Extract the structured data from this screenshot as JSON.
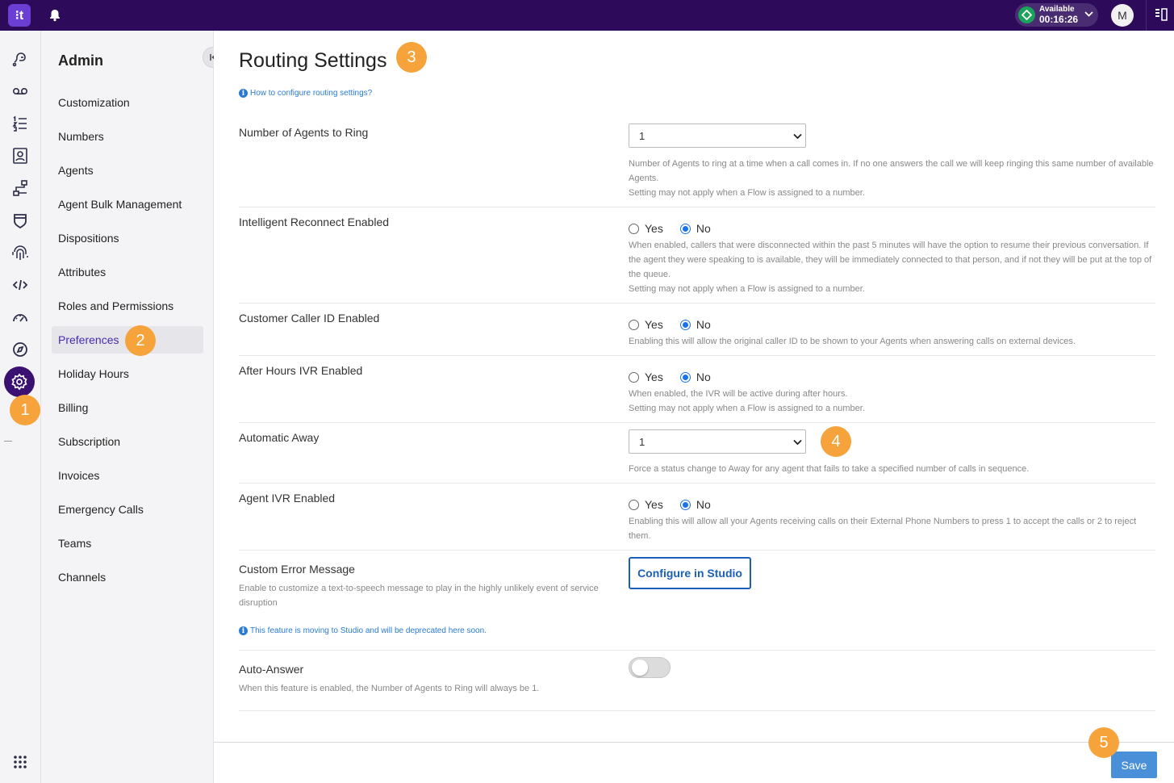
{
  "topbar": {
    "logo_text": "⁝t",
    "status_label": "Available",
    "status_timer": "00:16:26",
    "avatar_initial": "M",
    "bg_color": "#2d0b5a",
    "status_color": "#1aa35b"
  },
  "rail": {
    "icons": [
      "conversations-icon",
      "voicemail-icon",
      "list-icon",
      "contacts-icon",
      "flows-icon",
      "shield-icon",
      "fingerprint-icon",
      "code-icon",
      "dashboard-icon",
      "compass-icon",
      "settings-icon",
      "apps-grid-icon"
    ],
    "active": "settings-icon"
  },
  "sidebar": {
    "title": "Admin",
    "items": [
      {
        "label": "Customization"
      },
      {
        "label": "Numbers"
      },
      {
        "label": "Agents"
      },
      {
        "label": "Agent Bulk Management"
      },
      {
        "label": "Dispositions"
      },
      {
        "label": "Attributes"
      },
      {
        "label": "Roles and Permissions"
      },
      {
        "label": "Preferences"
      },
      {
        "label": "Holiday Hours"
      },
      {
        "label": "Billing"
      },
      {
        "label": "Subscription"
      },
      {
        "label": "Invoices"
      },
      {
        "label": "Emergency Calls"
      },
      {
        "label": "Teams"
      },
      {
        "label": "Channels"
      }
    ],
    "active": "Preferences"
  },
  "badges": [
    "1",
    "2",
    "3",
    "4",
    "5"
  ],
  "main": {
    "title": "Routing Settings",
    "help_link": "How to configure routing settings?",
    "agents_to_ring": {
      "label": "Number of Agents to Ring",
      "value": "1",
      "desc1": "Number of Agents to ring at a time when a call comes in. If no one answers the call we will keep ringing this same number of available Agents.",
      "desc2": "Setting may not apply when a Flow is assigned to a number."
    },
    "intelligent_reconnect": {
      "label": "Intelligent Reconnect Enabled",
      "yes": "Yes",
      "no": "No",
      "selected": "No",
      "desc1": "When enabled, callers that were disconnected within the past 5 minutes will have the option to resume their previous conversation. If the agent they were speaking to is available, they will be immediately connected to that person, and if not they will be put at the top of the queue.",
      "desc2": "Setting may not apply when a Flow is assigned to a number."
    },
    "caller_id": {
      "label": "Customer Caller ID Enabled",
      "yes": "Yes",
      "no": "No",
      "selected": "No",
      "desc1": "Enabling this will allow the original caller ID to be shown to your Agents when answering calls on external devices."
    },
    "after_hours_ivr": {
      "label": "After Hours IVR Enabled",
      "yes": "Yes",
      "no": "No",
      "selected": "No",
      "desc1": "When enabled, the IVR will be active during after hours.",
      "desc2": "Setting may not apply when a Flow is assigned to a number."
    },
    "automatic_away": {
      "label": "Automatic Away",
      "value": "1",
      "desc1": "Force a status change to Away for any agent that fails to take a specified number of calls in sequence."
    },
    "agent_ivr": {
      "label": "Agent IVR Enabled",
      "yes": "Yes",
      "no": "No",
      "selected": "No",
      "desc1": "Enabling this will allow all your Agents receiving calls on their External Phone Numbers to press 1 to accept the calls or 2 to reject them."
    },
    "custom_error": {
      "label": "Custom Error Message",
      "sub": "Enable to customize a text-to-speech message to play in the highly unlikely event of service disruption",
      "notice": "This feature is moving to Studio and will be deprecated here soon.",
      "button": "Configure in Studio"
    },
    "auto_answer": {
      "label": "Auto-Answer",
      "sub": "When this feature is enabled, the Number of Agents to Ring will always be 1.",
      "enabled": false
    },
    "save_label": "Save"
  }
}
